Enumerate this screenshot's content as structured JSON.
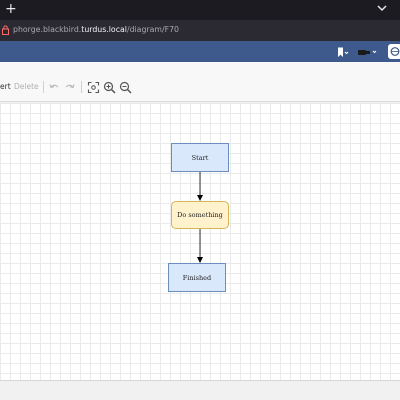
{
  "browser": {
    "new_tab_glyph": "+",
    "url_prefix": "phorge.blackbird.",
    "url_domain": "turdus.local",
    "url_path": "/diagram/F70"
  },
  "toolbar": {
    "insert_label": "ert",
    "delete_label": "Delete"
  },
  "diagram": {
    "nodes": {
      "start": "Start",
      "do": "Do something",
      "finished": "Finished"
    }
  },
  "colors": {
    "app_header": "#3e5a8c",
    "process_fill": "#dae8fc",
    "process_stroke": "#6c8ebf",
    "action_fill": "#fff2cc",
    "action_stroke": "#d6b656"
  },
  "icons": [
    "chevron-down-icon",
    "lock-icon",
    "bookmark-icon",
    "user-icon",
    "globe-icon",
    "undo-icon",
    "redo-icon",
    "fit-icon",
    "zoom-in-icon",
    "zoom-out-icon"
  ]
}
